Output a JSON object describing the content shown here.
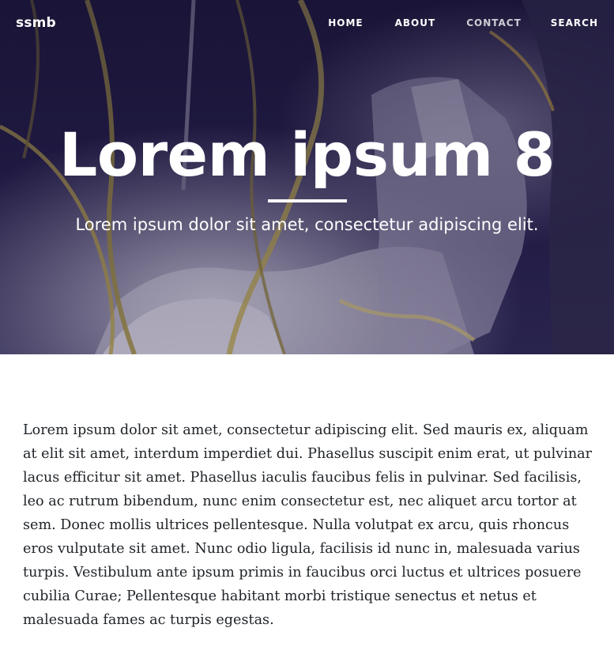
{
  "navbar": {
    "brand": "ssmb",
    "links": [
      {
        "label": "HOME",
        "active": false
      },
      {
        "label": "ABOUT",
        "active": false
      },
      {
        "label": "CONTACT",
        "active": true
      },
      {
        "label": "SEARCH",
        "active": false
      }
    ]
  },
  "hero": {
    "title": "Lorem ipsum 8",
    "subtitle": "Lorem ipsum dolor sit amet, consectetur adipiscing elit.",
    "background_image": "astronaut-spacewalk-photo"
  },
  "content": {
    "paragraph": "Lorem ipsum dolor sit amet, consectetur adipiscing elit. Sed mauris ex, aliquam at elit sit amet, interdum imperdiet dui. Phasellus suscipit enim erat, ut pulvinar lacus efficitur sit amet. Phasellus iaculis faucibus felis in pulvinar. Sed facilisis, leo ac rutrum bibendum, nunc enim consectetur est, nec aliquet arcu tortor at sem. Donec mollis ultrices pellentesque. Nulla volutpat ex arcu, quis rhoncus eros vulputate sit amet. Nunc odio ligula, facilisis id nunc in, malesuada varius turpis. Vestibulum ante ipsum primis in faucibus orci luctus et ultrices posuere cubilia Curae; Pellentesque habitant morbi tristique senectus et netus et malesuada fames ac turpis egestas."
  },
  "colors": {
    "hero_bg": "#1d1638",
    "nav_text": "#ffffff",
    "body_text": "#212529",
    "page_bg": "#ffffff"
  }
}
